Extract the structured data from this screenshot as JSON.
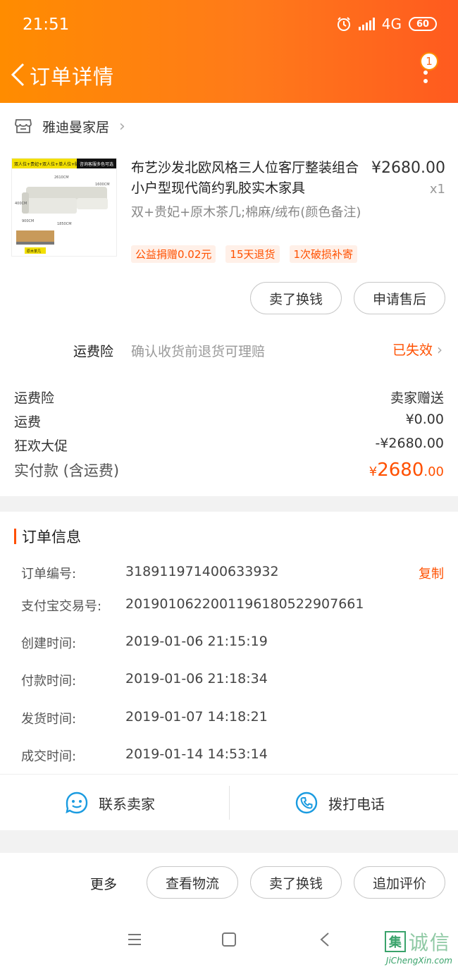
{
  "status_bar": {
    "time": "21:51",
    "network": "4G",
    "battery": "60"
  },
  "nav": {
    "title": "订单详情",
    "badge": "1"
  },
  "shop": {
    "name": "雅迪曼家居"
  },
  "product": {
    "name": "布艺沙发北欧风格三人位客厅整装组合小户型现代简约乳胶实木家具",
    "price": "¥2680.00",
    "qty": "x1",
    "spec": "双+贵妃+原木茶几;棉麻/绒布(颜色备注)",
    "tags": [
      "公益捐赠0.02元",
      "15天退货",
      "1次破损补寄"
    ],
    "image_text": {
      "top_left": "双人位+贵妃+双人位+单人位+脚踏",
      "top_right": "咨询客服多色可选",
      "dim_1": "2610CM",
      "dim_2": "1600CM",
      "dim_3": "1850CM",
      "dim_4": "900CM",
      "dim_5": "400CM",
      "table_label": "原木茶几"
    }
  },
  "item_actions": {
    "sell": "卖了换钱",
    "after_sale": "申请售后"
  },
  "insurance": {
    "label": "运费险",
    "desc": "确认收货前退货可理赔",
    "status": "已失效"
  },
  "fees": [
    {
      "label": "运费险",
      "value": "卖家赠送"
    },
    {
      "label": "运费",
      "value": "¥0.00"
    },
    {
      "label": "狂欢大促",
      "value": "-¥2680.00"
    }
  ],
  "total": {
    "label": "实付款 (含运费)",
    "yen": "¥",
    "int": "2680",
    "dec": ".00"
  },
  "order_info": {
    "title": "订单信息",
    "copy": "复制",
    "rows": [
      {
        "label": "订单编号:",
        "value": "318911971400633932"
      },
      {
        "label": "支付宝交易号:",
        "value": "2019010622001196180522907661"
      },
      {
        "label": "创建时间:",
        "value": "2019-01-06 21:15:19"
      },
      {
        "label": "付款时间:",
        "value": "2019-01-06 21:18:34"
      },
      {
        "label": "发货时间:",
        "value": "2019-01-07 14:18:21"
      },
      {
        "label": "成交时间:",
        "value": "2019-01-14 14:53:14"
      }
    ]
  },
  "contact": {
    "seller": "联系卖家",
    "call": "拨打电话"
  },
  "bottom": {
    "more": "更多",
    "logistics": "查看物流",
    "sell": "卖了换钱",
    "review": "追加评价"
  },
  "watermark": {
    "logo": "集",
    "text": "诚信",
    "url": "JiChengXin.com"
  },
  "colors": {
    "accent": "#ff5000",
    "header_start": "#ff8c00",
    "header_end": "#ff5a1f"
  }
}
